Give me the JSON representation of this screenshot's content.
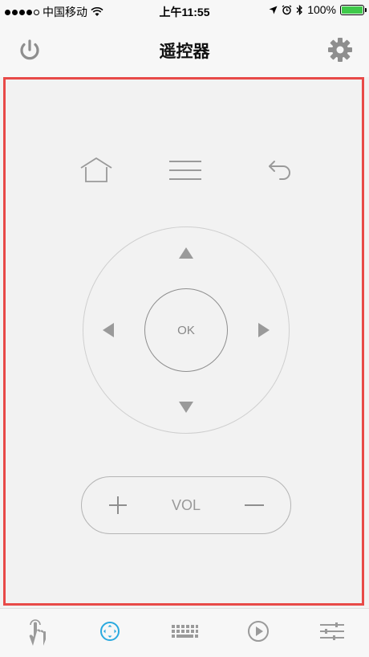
{
  "status_bar": {
    "carrier": "中国移动",
    "time": "上午11:55",
    "battery": "100%",
    "battery_color": "#3fc94a"
  },
  "nav": {
    "title": "遥控器",
    "left_icon": "power-icon",
    "right_icon": "gear-icon"
  },
  "panel": {
    "border_color": "#e84a48",
    "top_row": [
      "home-icon",
      "menu-icon",
      "back-icon"
    ],
    "ok_label": "OK",
    "arrows": [
      "arrow-up-icon",
      "arrow-down-icon",
      "arrow-left-icon",
      "arrow-right-icon"
    ],
    "vol_label": "VOL",
    "vol_plus": "+",
    "vol_minus": "−"
  },
  "tabs": [
    {
      "icon": "touch-hand-icon",
      "active": false
    },
    {
      "icon": "dpad-icon",
      "active": true
    },
    {
      "icon": "keyboard-icon",
      "active": false
    },
    {
      "icon": "play-icon",
      "active": false
    },
    {
      "icon": "sliders-icon",
      "active": false
    }
  ],
  "colors": {
    "active_tab": "#2aa9df",
    "inactive_tab": "#9a9a9a"
  }
}
